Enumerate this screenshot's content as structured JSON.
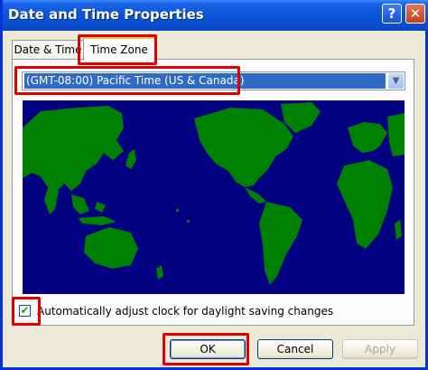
{
  "window": {
    "title": "Date and Time Properties",
    "help_glyph": "?",
    "close_glyph": "✕"
  },
  "tabs": [
    {
      "label": "Date & Time",
      "selected": false
    },
    {
      "label": "Time Zone",
      "selected": true
    }
  ],
  "time_zone": {
    "selected": "(GMT-08:00) Pacific Time (US & Canada)"
  },
  "dst": {
    "checked": true,
    "check_glyph": "✔",
    "label": "Automatically adjust clock for daylight saving changes"
  },
  "buttons": {
    "ok": "OK",
    "cancel": "Cancel",
    "apply": "Apply"
  },
  "colors": {
    "ocean": "#000080",
    "land": "#008000",
    "highlight": "#e00000",
    "selection": "#316ac5"
  }
}
